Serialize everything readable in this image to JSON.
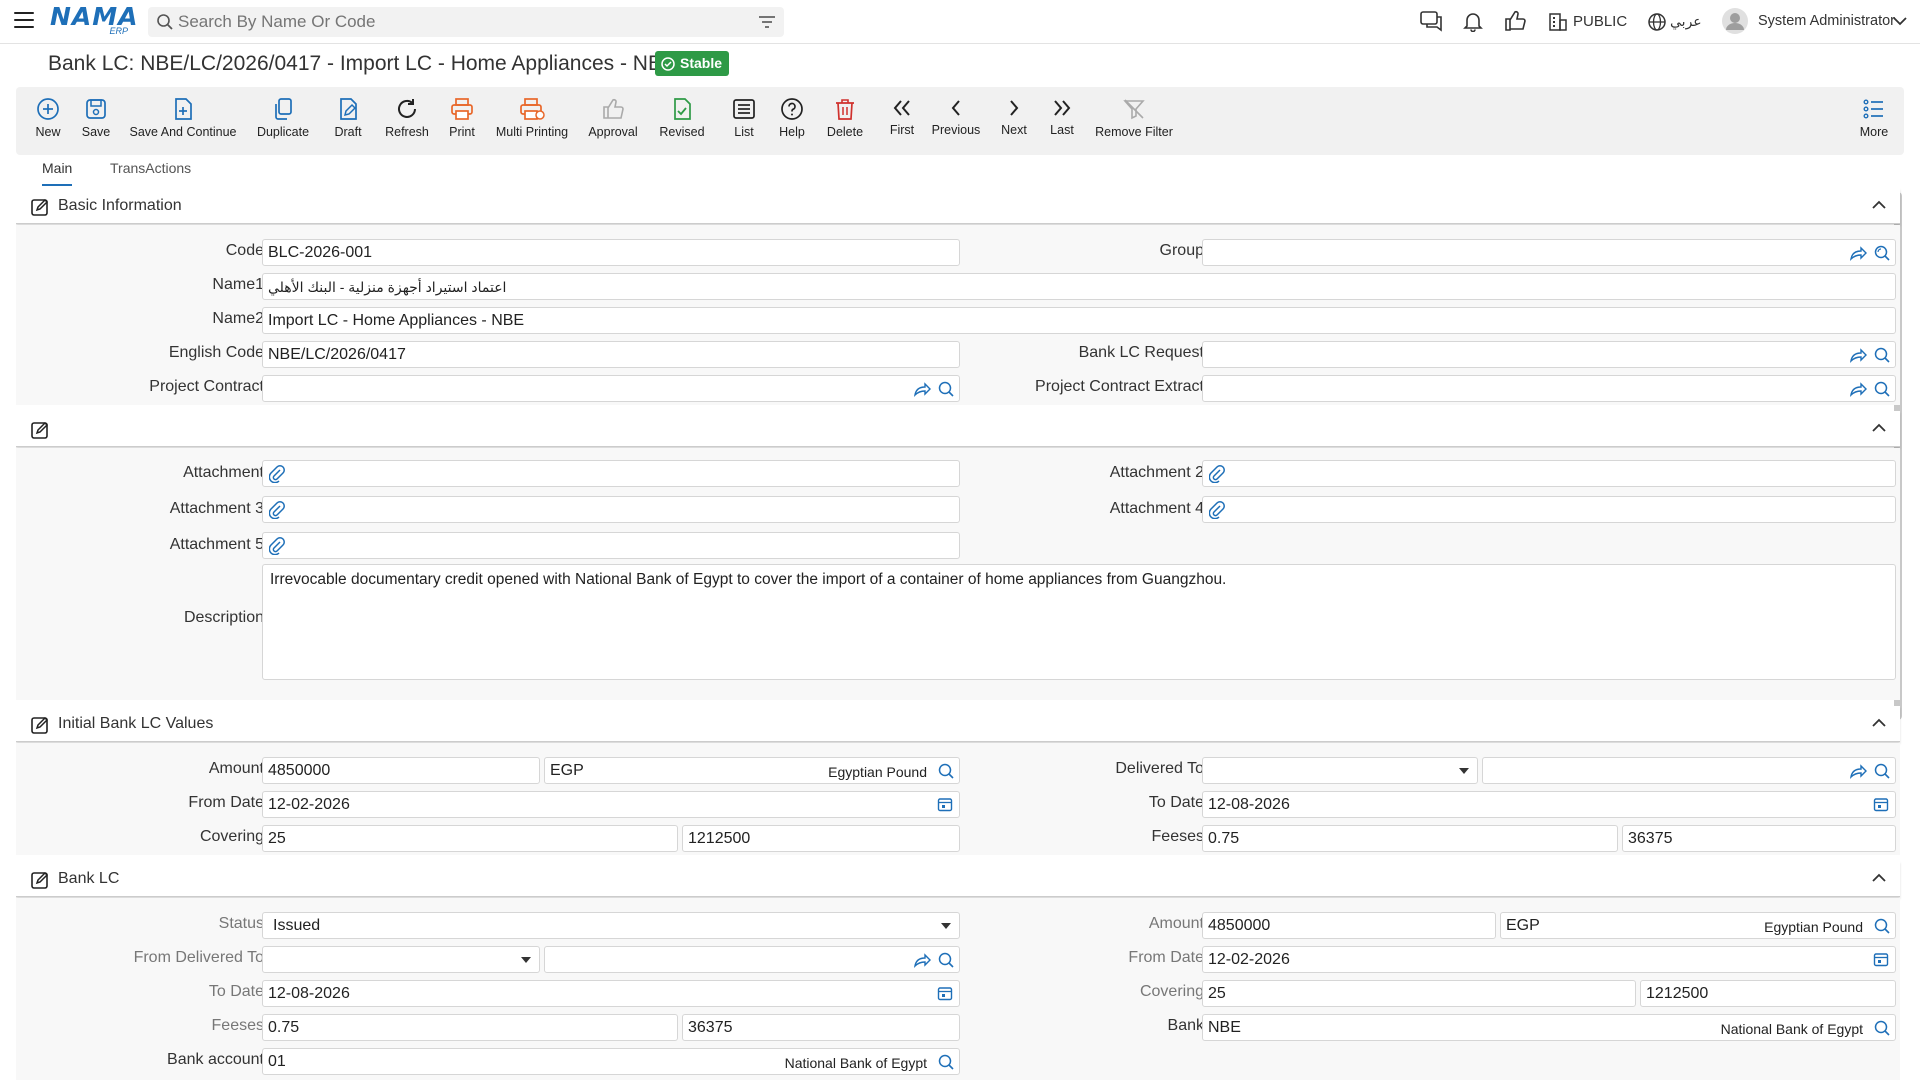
{
  "header": {
    "logo_text": "NAMA",
    "logo_sub": "ERP",
    "search_placeholder": "Search By Name Or Code",
    "public_label": "PUBLIC",
    "language_label": "عربي",
    "user_name": "System Administrator"
  },
  "page": {
    "title": "Bank LC: NBE/LC/2026/0417 - Import LC - Home Appliances - NBE",
    "status_badge": "Stable",
    "status_color": "#2e9a46",
    "accent_color": "#1e6fb8"
  },
  "toolbar": {
    "new": "New",
    "save": "Save",
    "save_continue": "Save And Continue",
    "duplicate": "Duplicate",
    "draft": "Draft",
    "refresh": "Refresh",
    "print": "Print",
    "multi_printing": "Multi Printing",
    "approval": "Approval",
    "revised": "Revised",
    "list": "List",
    "help": "Help",
    "delete": "Delete",
    "first": "First",
    "previous": "Previous",
    "next": "Next",
    "last": "Last",
    "remove_filter": "Remove Filter",
    "more": "More"
  },
  "tabs": {
    "main": "Main",
    "transactions": "TransActions"
  },
  "basic": {
    "title": "Basic Information",
    "code_label": "Code",
    "code": "BLC-2026-001",
    "group_label": "Group",
    "group": "",
    "name1_label": "Name1",
    "name1": "اعتماد استيراد أجهزة منزلية - البنك الأهلي",
    "name2_label": "Name2",
    "name2": "Import LC - Home Appliances - NBE",
    "english_code_label": "English Code",
    "english_code": "NBE/LC/2026/0417",
    "bank_lc_request_label": "Bank LC Request",
    "bank_lc_request": "",
    "project_contract_label": "Project Contract",
    "project_contract": "",
    "project_contract_extract_label": "Project Contract Extract",
    "project_contract_extract": ""
  },
  "attachments": {
    "attachment_label": "Attachment",
    "attachment2_label": "Attachment 2",
    "attachment3_label": "Attachment 3",
    "attachment4_label": "Attachment 4",
    "attachment5_label": "Attachment 5",
    "description_label": "Description",
    "description": "Irrevocable documentary credit opened with National Bank of Egypt to cover the import of a container of home appliances from Guangzhou."
  },
  "initial": {
    "title": "Initial Bank LC Values",
    "amount_label": "Amount",
    "amount": "4850000",
    "currency": "EGP",
    "currency_name": "Egyptian Pound",
    "delivered_to_label": "Delivered To",
    "delivered_to": "",
    "delivered_to_ref": "",
    "from_date_label": "From Date",
    "from_date": "12-02-2026",
    "to_date_label": "To Date",
    "to_date": "12-08-2026",
    "covering_label": "Covering",
    "covering_pct": "25",
    "covering_value": "1212500",
    "fees_label": "Feeses",
    "fees_pct": "0.75",
    "fees_value": "36375"
  },
  "bank_lc": {
    "title": "Bank LC",
    "status_label": "Status",
    "status": "Issued",
    "amount_label": "Amount",
    "amount": "4850000",
    "currency": "EGP",
    "currency_name": "Egyptian Pound",
    "from_delivered_to_label": "From Delivered To",
    "from_delivered_to": "",
    "from_delivered_to_ref": "",
    "from_date_label": "From Date",
    "from_date": "12-02-2026",
    "to_date_label": "To Date",
    "to_date": "12-08-2026",
    "covering_label": "Covering",
    "covering_pct": "25",
    "covering_value": "1212500",
    "fees_label": "Feeses",
    "fees_pct": "0.75",
    "fees_value": "36375",
    "bank_label": "Bank",
    "bank": "NBE",
    "bank_name": "National Bank of Egypt",
    "bank_account_label": "Bank account",
    "bank_account": "01",
    "bank_account_name": "National Bank of Egypt"
  }
}
